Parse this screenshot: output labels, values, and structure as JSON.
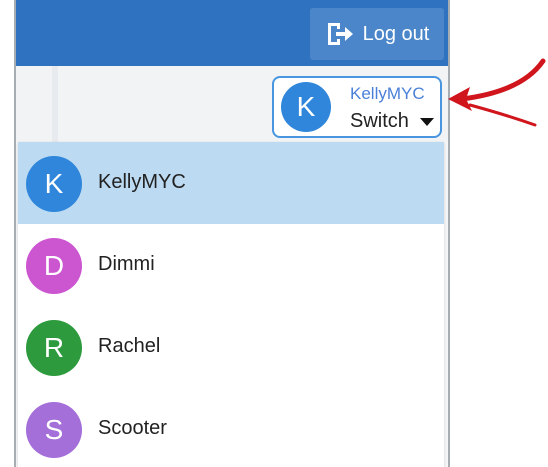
{
  "header": {
    "logout_label": "Log out",
    "logout_icon": "logout-icon"
  },
  "switcher": {
    "initial": "K",
    "username": "KellyMYC",
    "action_label": "Switch",
    "avatar_color": "#2f86db",
    "border_color": "#4a95e0"
  },
  "menu": {
    "items": [
      {
        "initial": "K",
        "name": "KellyMYC",
        "color": "#2f86db",
        "selected": true
      },
      {
        "initial": "D",
        "name": "Dimmi",
        "color": "#cc55d0",
        "selected": false
      },
      {
        "initial": "R",
        "name": "Rachel",
        "color": "#2e9a3e",
        "selected": false
      },
      {
        "initial": "S",
        "name": "Scooter",
        "color": "#a46fd8",
        "selected": false
      }
    ]
  },
  "colors": {
    "top_bar": "#2f73c0",
    "selected_row": "#bcdaf2",
    "annotation_arrow": "#d0151c"
  }
}
